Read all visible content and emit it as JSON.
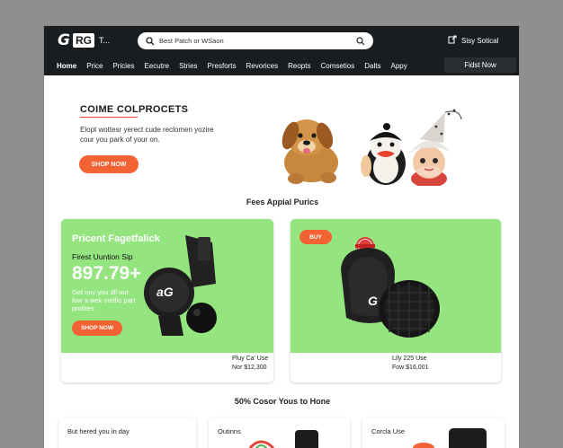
{
  "header": {
    "logo_g": "G",
    "logo_box": "RG",
    "logo_suffix": "T...",
    "search_value": "Best Patch or WSaon",
    "account_label": "Sisy Sotical",
    "nav": [
      "Home",
      "Price",
      "Pricies",
      "Eecutre",
      "Stries",
      "Presforts",
      "Revorices",
      "Reopts",
      "Comsetios",
      "Dalts",
      "Appy"
    ],
    "nav_cta": "Fidst Now"
  },
  "hero": {
    "title": "COIME COLPROCETS",
    "subtitle": "Elopt wottesr yerect cude reclomen yozire cour you park of your on.",
    "button": "SHOP NOW"
  },
  "featured": {
    "title": "Fees Appial Purics",
    "cards": [
      {
        "title": "Pricent Fagetfalick",
        "subtitle": "Firest Uuntion Sip",
        "price": "897.79+",
        "description": "Get nov you dll out fow a wek melfio part profites",
        "button": "SHOP NOW",
        "product_mark": "aG",
        "footer": [
          "Pluy Ca' Use",
          "Nor $12,300"
        ]
      },
      {
        "badge": "BUY",
        "product_mark": "G",
        "footer": [
          "Lily 225 Use",
          "Fow $16,001"
        ]
      }
    ]
  },
  "promo": {
    "title": "50% Cosor Yous to Hone",
    "items": [
      "But hered you in day",
      "Outinns",
      "Corcla Use"
    ]
  },
  "colors": {
    "topbar": "#1a1d20",
    "accent": "#f26232",
    "card_green": "#94e47f"
  }
}
